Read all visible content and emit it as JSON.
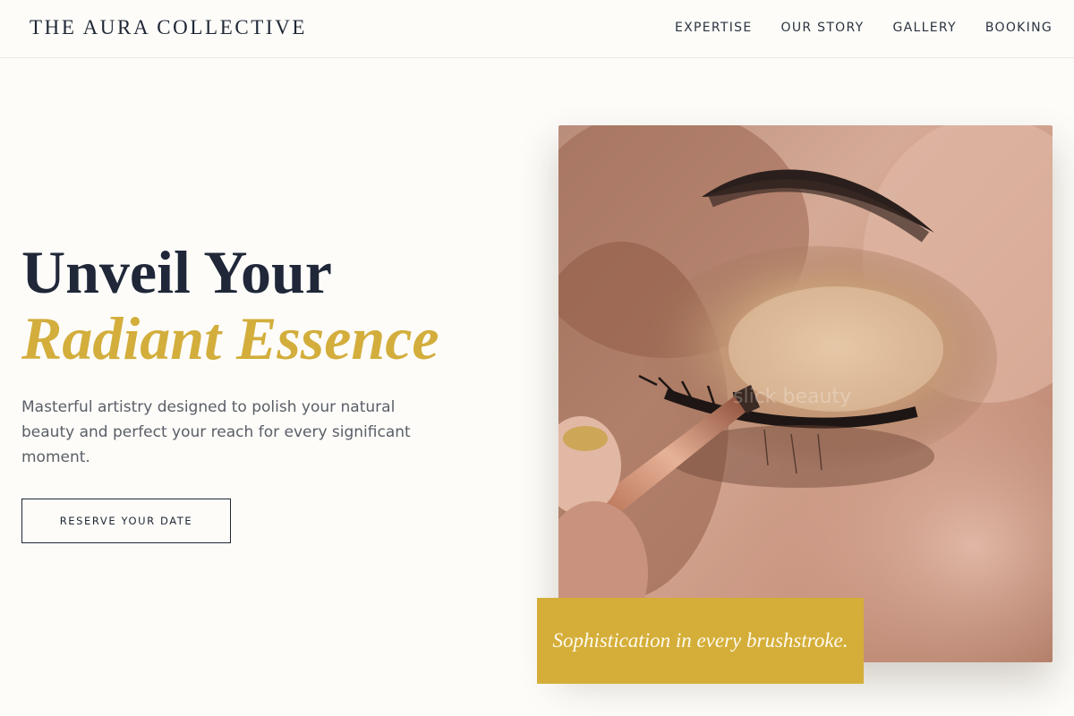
{
  "header": {
    "brand": "THE AURA COLLECTIVE",
    "nav": [
      "EXPERTISE",
      "OUR STORY",
      "GALLERY",
      "BOOKING"
    ]
  },
  "hero": {
    "title_line1": "Unveil Your",
    "title_line2": "Radiant Essence",
    "description": "Masterful artistry designed to polish your natural beauty and perfect your reach for every significant moment.",
    "cta_label": "RESERVE YOUR DATE"
  },
  "image": {
    "subject": "close-up of eye makeup application with a brush",
    "caption": "Sophistication in every brushstroke."
  },
  "colors": {
    "background": "#fdfcf9",
    "navy": "#1f2738",
    "gold": "#d3ae3c",
    "caption_bg": "#d4ae38"
  }
}
